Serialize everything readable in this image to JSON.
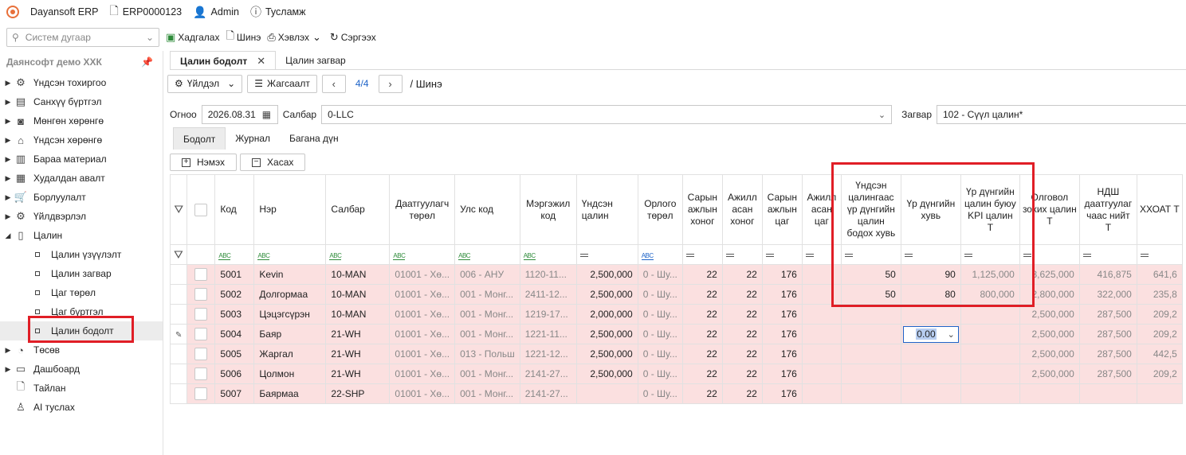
{
  "header": {
    "app_name": "Dayansoft ERP",
    "doc_id": "ERP0000123",
    "user": "Admin",
    "help": "Тусламж"
  },
  "toolbar": {
    "search_placeholder": "Систем дугаар",
    "save": "Хадгалах",
    "new": "Шинэ",
    "print": "Хэвлэх",
    "refresh": "Сэргээх"
  },
  "sidebar": {
    "company": "Даянсофт демо ХХК",
    "items": [
      {
        "label": "Үндсэн тохиргоо",
        "icon": "gear-icon"
      },
      {
        "label": "Санхүү бүртгэл",
        "icon": "ledger-icon"
      },
      {
        "label": "Мөнгөн хөрөнгө",
        "icon": "cash-icon"
      },
      {
        "label": "Үндсэн хөрөнгө",
        "icon": "building-icon"
      },
      {
        "label": "Бараа материал",
        "icon": "box-icon"
      },
      {
        "label": "Худалдан авалт",
        "icon": "purchase-icon"
      },
      {
        "label": "Борлуулалт",
        "icon": "cart-icon"
      },
      {
        "label": "Үйлдвэрлэл",
        "icon": "factory-icon"
      },
      {
        "label": "Цалин",
        "icon": "payroll-icon"
      }
    ],
    "payroll_sub": [
      "Цалин үзүүлэлт",
      "Цалин загвар",
      "Цаг төрөл",
      "Цаг бүртгэл",
      "Цалин бодолт"
    ],
    "after": [
      {
        "label": "Төсөв",
        "icon": "pie-icon"
      },
      {
        "label": "Дашбоард",
        "icon": "dashboard-icon"
      },
      {
        "label": "Тайлан",
        "icon": "report-icon"
      },
      {
        "label": "AI туслах",
        "icon": "ai-icon"
      }
    ]
  },
  "tabs": [
    {
      "label": "Цалин бодолт",
      "active": true
    },
    {
      "label": "Цалин загвар",
      "active": false
    }
  ],
  "actions": {
    "action_menu": "Үйлдэл",
    "list": "Жагсаалт",
    "pager": "4/4",
    "crumb": "/ Шинэ"
  },
  "filters": {
    "date_label": "Огноо",
    "date": "2026.08.31",
    "branch_label": "Салбар",
    "branch": "0-LLC",
    "template_label": "Загвар",
    "template": "102 - Сүүл цалин*"
  },
  "subtabs": [
    "Бодолт",
    "Журнал",
    "Багана дүн"
  ],
  "grid_buttons": {
    "add": "Нэмэх",
    "remove": "Хасах"
  },
  "grid": {
    "columns": [
      "Код",
      "Нэр",
      "Салбар",
      "Даатгуулагч төрөл",
      "Улс код",
      "Мэргэжил код",
      "Үндсэн цалин",
      "Орлого төрөл",
      "Сарын ажлын хоног",
      "Ажилл асан хоног",
      "Сарын ажлын цаг",
      "Ажилл асан цаг",
      "Үндсэн цалингаас үр дүнгийн цалин бодох хувь",
      "Үр дүнгийн хувь",
      "Үр дүнгийн цалин буюу KPI цалин Т",
      "Олговол зохих цалин Т",
      "НДШ даатгуулаг чаас нийт Т",
      "ХХОАТ Т"
    ],
    "rows": [
      [
        "5001",
        "Kevin",
        "10-MAN",
        "01001 - Хө...",
        "006 - АНУ",
        "1120-11...",
        "2,500,000",
        "0 - Шу...",
        "22",
        "22",
        "176",
        "",
        "50",
        "90",
        "1,125,000",
        "3,625,000",
        "416,875",
        "641,6"
      ],
      [
        "5002",
        "Долгормаа",
        "10-MAN",
        "01001 - Хө...",
        "001 - Монг...",
        "2411-12...",
        "2,500,000",
        "0 - Шу...",
        "22",
        "22",
        "176",
        "",
        "50",
        "80",
        "800,000",
        "2,800,000",
        "322,000",
        "235,8"
      ],
      [
        "5003",
        "Цэцэгсүрэн",
        "10-MAN",
        "01001 - Хө...",
        "001 - Монг...",
        "1219-17...",
        "2,000,000",
        "0 - Шу...",
        "22",
        "22",
        "176",
        "",
        "",
        "",
        "",
        "2,500,000",
        "287,500",
        "209,2"
      ],
      [
        "5004",
        "Баяр",
        "21-WH",
        "01001 - Хө...",
        "001 - Монг...",
        "1221-11...",
        "2,500,000",
        "0 - Шу...",
        "22",
        "22",
        "176",
        "",
        "",
        "0.00",
        "",
        "2,500,000",
        "287,500",
        "209,2"
      ],
      [
        "5005",
        "Жаргал",
        "21-WH",
        "01001 - Хө...",
        "013 - Польш",
        "1221-12...",
        "2,500,000",
        "0 - Шу...",
        "22",
        "22",
        "176",
        "",
        "",
        "",
        "",
        "2,500,000",
        "287,500",
        "442,5"
      ],
      [
        "5006",
        "Цолмон",
        "21-WH",
        "01001 - Хө...",
        "001 - Монг...",
        "2141-27...",
        "2,500,000",
        "0 - Шу...",
        "22",
        "22",
        "176",
        "",
        "",
        "",
        "",
        "2,500,000",
        "287,500",
        "209,2"
      ],
      [
        "5007",
        "Баярмаа",
        "22-SHP",
        "01001 - Хө...",
        "001 - Монг...",
        "2141-27...",
        "",
        "0 - Шу...",
        "22",
        "22",
        "176",
        "",
        "",
        "",
        "",
        "",
        "",
        ""
      ]
    ]
  },
  "colors": {
    "highlight_box": "#e01e26",
    "row_pink": "#fbe0e0",
    "link_blue": "#1e64c8"
  }
}
